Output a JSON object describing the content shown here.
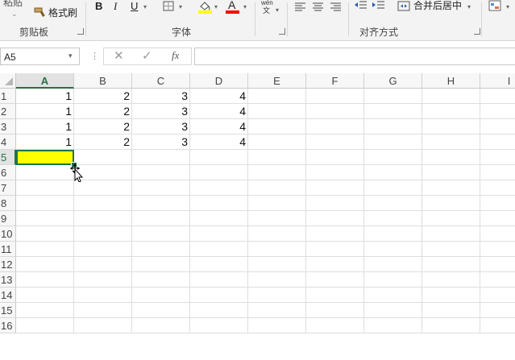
{
  "ribbon": {
    "paste_label": "粘贴",
    "format_painter_label": "格式刷",
    "bold_label": "B",
    "italic_label": "I",
    "underline_label": "U",
    "font_color_label": "A",
    "phonetic_top": "wén",
    "phonetic_bottom": "文",
    "merge_center_label": "合并后居中",
    "groups": {
      "clipboard": "剪贴板",
      "font": "字体",
      "alignment": "对齐方式"
    },
    "colors": {
      "fill": "#ffff00",
      "font": "#ff0000",
      "accent": "#217346"
    }
  },
  "formula_bar": {
    "name_box": "A5",
    "fx_label": "fx",
    "formula": ""
  },
  "sheet": {
    "columns": [
      "A",
      "B",
      "C",
      "D",
      "E",
      "F",
      "G",
      "H",
      "I"
    ],
    "selected_column": "A",
    "rows": [
      "1",
      "2",
      "3",
      "4",
      "5",
      "6",
      "7",
      "8",
      "9",
      "10",
      "11",
      "12",
      "13",
      "14",
      "15",
      "16"
    ],
    "selected_row": "5",
    "data": [
      [
        "1",
        "2",
        "3",
        "4"
      ],
      [
        "1",
        "2",
        "3",
        "4"
      ],
      [
        "1",
        "2",
        "3",
        "4"
      ],
      [
        "1",
        "2",
        "3",
        "4"
      ]
    ],
    "active_cell": "A5",
    "active_fill": "#ffff00"
  }
}
